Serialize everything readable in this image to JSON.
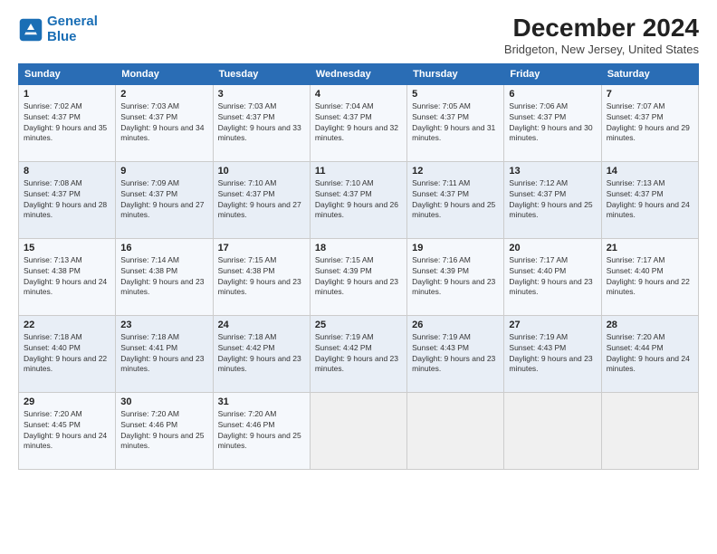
{
  "header": {
    "logo_line1": "General",
    "logo_line2": "Blue",
    "title": "December 2024",
    "subtitle": "Bridgeton, New Jersey, United States"
  },
  "columns": [
    "Sunday",
    "Monday",
    "Tuesday",
    "Wednesday",
    "Thursday",
    "Friday",
    "Saturday"
  ],
  "weeks": [
    [
      {
        "day": "1",
        "sunrise": "7:02 AM",
        "sunset": "4:37 PM",
        "daylight": "9 hours and 35 minutes."
      },
      {
        "day": "2",
        "sunrise": "7:03 AM",
        "sunset": "4:37 PM",
        "daylight": "9 hours and 34 minutes."
      },
      {
        "day": "3",
        "sunrise": "7:03 AM",
        "sunset": "4:37 PM",
        "daylight": "9 hours and 33 minutes."
      },
      {
        "day": "4",
        "sunrise": "7:04 AM",
        "sunset": "4:37 PM",
        "daylight": "9 hours and 32 minutes."
      },
      {
        "day": "5",
        "sunrise": "7:05 AM",
        "sunset": "4:37 PM",
        "daylight": "9 hours and 31 minutes."
      },
      {
        "day": "6",
        "sunrise": "7:06 AM",
        "sunset": "4:37 PM",
        "daylight": "9 hours and 30 minutes."
      },
      {
        "day": "7",
        "sunrise": "7:07 AM",
        "sunset": "4:37 PM",
        "daylight": "9 hours and 29 minutes."
      }
    ],
    [
      {
        "day": "8",
        "sunrise": "7:08 AM",
        "sunset": "4:37 PM",
        "daylight": "9 hours and 28 minutes."
      },
      {
        "day": "9",
        "sunrise": "7:09 AM",
        "sunset": "4:37 PM",
        "daylight": "9 hours and 27 minutes."
      },
      {
        "day": "10",
        "sunrise": "7:10 AM",
        "sunset": "4:37 PM",
        "daylight": "9 hours and 27 minutes."
      },
      {
        "day": "11",
        "sunrise": "7:10 AM",
        "sunset": "4:37 PM",
        "daylight": "9 hours and 26 minutes."
      },
      {
        "day": "12",
        "sunrise": "7:11 AM",
        "sunset": "4:37 PM",
        "daylight": "9 hours and 25 minutes."
      },
      {
        "day": "13",
        "sunrise": "7:12 AM",
        "sunset": "4:37 PM",
        "daylight": "9 hours and 25 minutes."
      },
      {
        "day": "14",
        "sunrise": "7:13 AM",
        "sunset": "4:37 PM",
        "daylight": "9 hours and 24 minutes."
      }
    ],
    [
      {
        "day": "15",
        "sunrise": "7:13 AM",
        "sunset": "4:38 PM",
        "daylight": "9 hours and 24 minutes."
      },
      {
        "day": "16",
        "sunrise": "7:14 AM",
        "sunset": "4:38 PM",
        "daylight": "9 hours and 23 minutes."
      },
      {
        "day": "17",
        "sunrise": "7:15 AM",
        "sunset": "4:38 PM",
        "daylight": "9 hours and 23 minutes."
      },
      {
        "day": "18",
        "sunrise": "7:15 AM",
        "sunset": "4:39 PM",
        "daylight": "9 hours and 23 minutes."
      },
      {
        "day": "19",
        "sunrise": "7:16 AM",
        "sunset": "4:39 PM",
        "daylight": "9 hours and 23 minutes."
      },
      {
        "day": "20",
        "sunrise": "7:17 AM",
        "sunset": "4:40 PM",
        "daylight": "9 hours and 23 minutes."
      },
      {
        "day": "21",
        "sunrise": "7:17 AM",
        "sunset": "4:40 PM",
        "daylight": "9 hours and 22 minutes."
      }
    ],
    [
      {
        "day": "22",
        "sunrise": "7:18 AM",
        "sunset": "4:40 PM",
        "daylight": "9 hours and 22 minutes."
      },
      {
        "day": "23",
        "sunrise": "7:18 AM",
        "sunset": "4:41 PM",
        "daylight": "9 hours and 23 minutes."
      },
      {
        "day": "24",
        "sunrise": "7:18 AM",
        "sunset": "4:42 PM",
        "daylight": "9 hours and 23 minutes."
      },
      {
        "day": "25",
        "sunrise": "7:19 AM",
        "sunset": "4:42 PM",
        "daylight": "9 hours and 23 minutes."
      },
      {
        "day": "26",
        "sunrise": "7:19 AM",
        "sunset": "4:43 PM",
        "daylight": "9 hours and 23 minutes."
      },
      {
        "day": "27",
        "sunrise": "7:19 AM",
        "sunset": "4:43 PM",
        "daylight": "9 hours and 23 minutes."
      },
      {
        "day": "28",
        "sunrise": "7:20 AM",
        "sunset": "4:44 PM",
        "daylight": "9 hours and 24 minutes."
      }
    ],
    [
      {
        "day": "29",
        "sunrise": "7:20 AM",
        "sunset": "4:45 PM",
        "daylight": "9 hours and 24 minutes."
      },
      {
        "day": "30",
        "sunrise": "7:20 AM",
        "sunset": "4:46 PM",
        "daylight": "9 hours and 25 minutes."
      },
      {
        "day": "31",
        "sunrise": "7:20 AM",
        "sunset": "4:46 PM",
        "daylight": "9 hours and 25 minutes."
      },
      null,
      null,
      null,
      null
    ]
  ]
}
